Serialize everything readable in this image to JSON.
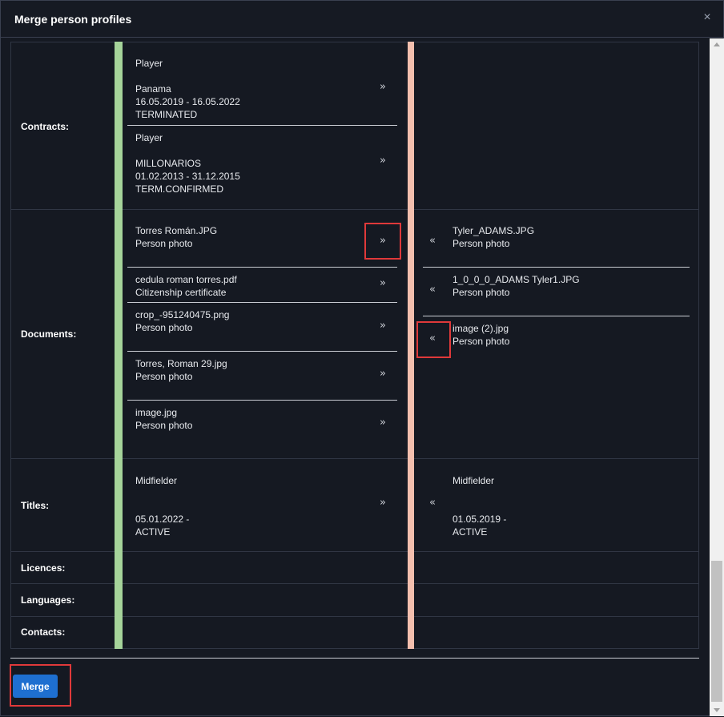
{
  "dialog": {
    "title": "Merge person profiles",
    "close_icon": "×",
    "merge_label": "Merge"
  },
  "labels": {
    "contracts": "Contracts:",
    "documents": "Documents:",
    "titles": "Titles:",
    "licences": "Licences:",
    "languages": "Languages:",
    "contacts": "Contacts:"
  },
  "contracts_left": [
    {
      "role": "Player",
      "club": "Panama",
      "period": "16.05.2019 - 16.05.2022",
      "status": "TERMINATED"
    },
    {
      "role": "Player",
      "club": "MILLONARIOS",
      "period": "01.02.2013 - 31.12.2015",
      "status": "TERM.CONFIRMED"
    }
  ],
  "documents_left": [
    {
      "file": "Torres Román.JPG",
      "type": "Person photo"
    },
    {
      "file": "cedula roman torres.pdf",
      "type": "Citizenship certificate"
    },
    {
      "file": "crop_-951240475.png",
      "type": "Person photo"
    },
    {
      "file": "Torres, Roman 29.jpg",
      "type": "Person photo"
    },
    {
      "file": "image.jpg",
      "type": "Person photo"
    }
  ],
  "documents_right": [
    {
      "file": "Tyler_ADAMS.JPG",
      "type": "Person photo"
    },
    {
      "file": "1_0_0_0_ADAMS Tyler1.JPG",
      "type": "Person photo"
    },
    {
      "file": "image (2).jpg",
      "type": "Person photo"
    }
  ],
  "titles_left": {
    "position": "Midfielder",
    "period": "05.01.2022 -",
    "status": "ACTIVE"
  },
  "titles_right": {
    "position": "Midfielder",
    "period": "01.05.2019 -",
    "status": "ACTIVE"
  },
  "arrows": {
    "move_right": "»",
    "move_left": "«"
  },
  "colors": {
    "left_profile": "#a6d49a",
    "right_profile": "#f3bfae",
    "highlight": "#e0393a",
    "primary_button": "#1e6fd0"
  }
}
